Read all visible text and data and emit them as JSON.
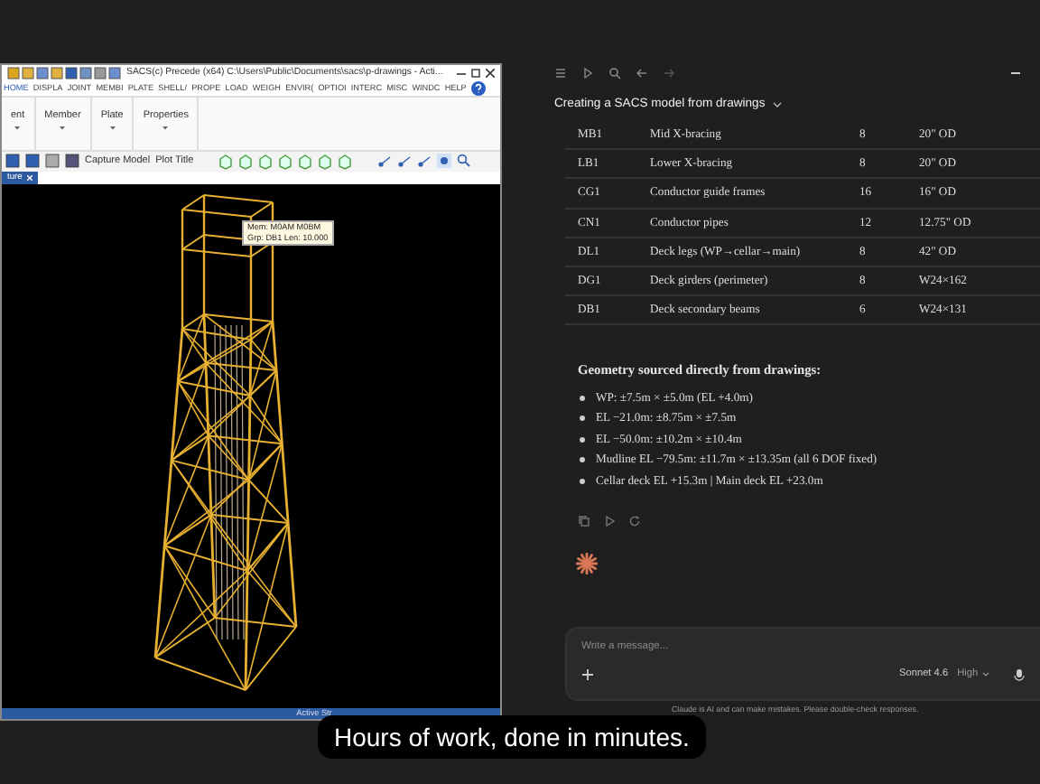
{
  "sacs_window": {
    "title": "SACS(c) Precede (x64)  C:\\Users\\Public\\Documents\\sacs\\p-drawings - Acti...",
    "menu": [
      {
        "label": "HOME",
        "selected": true
      },
      {
        "label": "DISPLA",
        "selected": false
      },
      {
        "label": "JOINT",
        "selected": false
      },
      {
        "label": "MEMBI",
        "selected": false
      },
      {
        "label": "PLATE",
        "selected": false
      },
      {
        "label": "SHELL/",
        "selected": false
      },
      {
        "label": "PROPE",
        "selected": false
      },
      {
        "label": "LOAD",
        "selected": false
      },
      {
        "label": "WEIGH",
        "selected": false
      },
      {
        "label": "ENVIR(",
        "selected": false
      },
      {
        "label": "OPTIOI",
        "selected": false
      },
      {
        "label": "INTERC",
        "selected": false
      },
      {
        "label": "MISC",
        "selected": false
      },
      {
        "label": "WINDC",
        "selected": false
      },
      {
        "label": "HELP",
        "selected": false
      }
    ],
    "ribbon_groups": [
      "ent",
      "Member",
      "Plate",
      "Properties"
    ],
    "toolbar": [
      "Capture Model",
      "Plot Title"
    ],
    "document_tab": "ture",
    "tooltip": [
      "Mem: M0AM M0BM",
      "Grp: DB1 Len: 10.000"
    ],
    "status": "Active Str"
  },
  "chat": {
    "title": "Creating a SACS model from drawings",
    "table_rows": [
      [
        "MB1",
        "Mid X-bracing",
        "8",
        "20\" OD"
      ],
      [
        "LB1",
        "Lower X-bracing",
        "8",
        "20\" OD"
      ],
      [
        "CG1",
        "Conductor guide frames",
        "16",
        "16\" OD"
      ],
      [
        "CN1",
        "Conductor pipes",
        "12",
        "12.75\" OD"
      ],
      [
        "DL1",
        "Deck legs (WP→cellar→main)",
        "8",
        "42\" OD"
      ],
      [
        "DG1",
        "Deck girders (perimeter)",
        "8",
        "W24×162"
      ],
      [
        "DB1",
        "Deck secondary beams",
        "6",
        "W24×131"
      ]
    ],
    "heading": "Geometry sourced directly from drawings:",
    "bullets": [
      "WP: ±7.5m × ±5.0m (EL +4.0m)",
      "EL −21.0m: ±8.75m × ±7.5m",
      "EL −50.0m: ±10.2m × ±10.4m",
      "Mudline EL −79.5m: ±11.7m × ±13.35m (all 6 DOF fixed)",
      "Cellar deck EL +15.3m | Main deck EL +23.0m"
    ],
    "input": {
      "placeholder": "Write a message..."
    },
    "model": "Sonnet 4.6",
    "effort": "High",
    "disclaimer": "Claude is AI and can make mistakes. Please double-check responses."
  },
  "caption": "Hours of work, done in minutes."
}
